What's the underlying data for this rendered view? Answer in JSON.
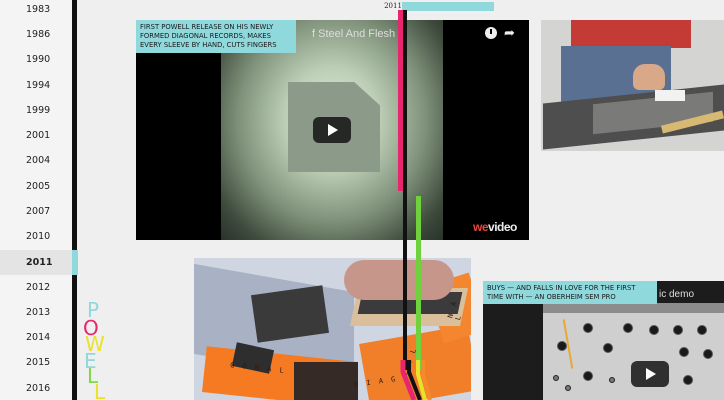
{
  "sidebar": {
    "years": [
      "1983",
      "1986",
      "1990",
      "1994",
      "1999",
      "2001",
      "2004",
      "2005",
      "2007",
      "2010",
      "2011",
      "2012",
      "2013",
      "2014",
      "2015",
      "2016"
    ],
    "active_year": "2011"
  },
  "logo": {
    "letters": [
      "P",
      "O",
      "W",
      "E",
      "L",
      "L"
    ]
  },
  "timeline": {
    "current_year": "2011"
  },
  "video1": {
    "title": "f Steel And Flesh",
    "caption": "FIRST POWELL RELEASE ON HIS NEWLY FORMED DIAGONAL RECORDS, MAKES EVERY SLEEVE BY HAND, CUTS FINGERS",
    "share_icon": "share-icon",
    "watch_later_icon": "clock-icon",
    "watermark": {
      "we": "we",
      "rest": "video"
    }
  },
  "photo2": {
    "texts": [
      "G O N A L",
      "N A L",
      "D I A G",
      "N A L"
    ]
  },
  "video2": {
    "title": "ic demo",
    "caption": "BUYS — AND FALLS IN LOVE FOR THE FIRST TIME WITH — AN OBERHEIM SEM PRO"
  },
  "colors": {
    "accent_cyan": "#8fd9dc",
    "line_pink": "#e8266e",
    "line_green": "#6fd23c",
    "line_orange": "#f58a2a",
    "line_yellow": "#e8e22a",
    "logo_pink": "#e8266e",
    "logo_green": "#7fd84a",
    "logo_yellow": "#e8e22a",
    "logo_cyan": "#8fd9dc"
  }
}
